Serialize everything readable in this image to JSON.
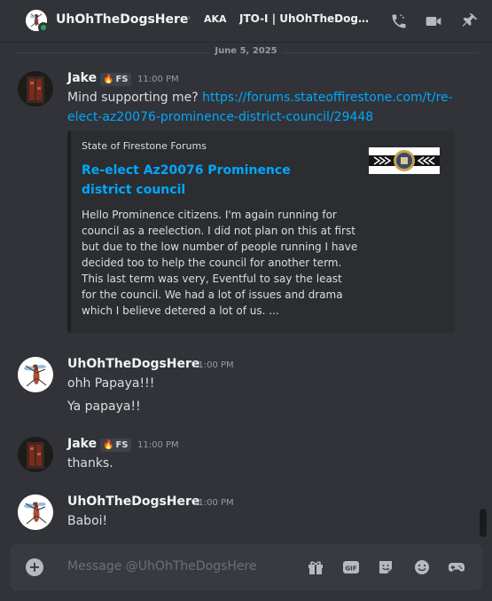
{
  "header": {
    "name": "UhOhTheDogsHere",
    "aka_label": "AKA",
    "aka_text": "JTO-I | UhOhTheDogsH..."
  },
  "date_divider": "June 5, 2025",
  "messages": [
    {
      "author": "Jake",
      "tag": "FS",
      "time": "11:00 PM",
      "text": "Mind supporting me?",
      "link": "https://forums.stateoffirestone.com/t/re-elect-az20076-prominence-district-council/29448",
      "link_line1": "https://forums.stateoffirestone.com/t/re-",
      "link_line2": "elect-az20076-prominence-district-council/29448",
      "embed": {
        "provider": "State of Firestone Forums",
        "title": "Re-elect Az20076 Prominence district council",
        "description": "Hello Prominence citizens. I'm again running for council as a reelection. I did not plan on this at first but due to the low number of people running I have decided too to help the council for another term. This last term was very, Eventful to say the least for the council. We had a lot of issues and drama which I believe detered a lot of us. ..."
      }
    },
    {
      "author": "UhOhTheDogsHere",
      "time": "11:00 PM",
      "lines": [
        "ohh Papaya!!!",
        "Ya papaya!!"
      ]
    },
    {
      "author": "Jake",
      "tag": "FS",
      "time": "11:00 PM",
      "text": "thanks."
    },
    {
      "author": "UhOhTheDogsHere",
      "time": "11:00 PM",
      "text": "Baboi!"
    }
  ],
  "input": {
    "placeholder": "Message @UhOhTheDogsHere",
    "gif_label": "GIF"
  },
  "colors": {
    "background": "#313338",
    "link": "#00a8fc",
    "online": "#23a55a"
  }
}
